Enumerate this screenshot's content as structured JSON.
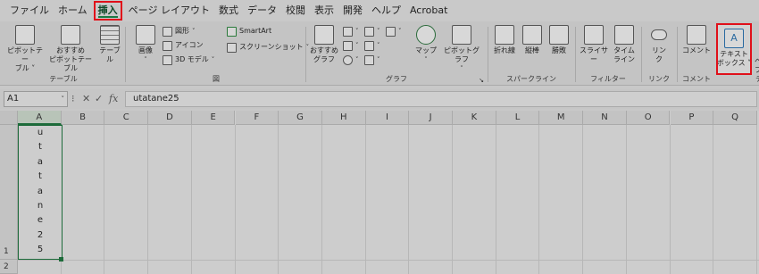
{
  "tabs": [
    "ファイル",
    "ホーム",
    "挿入",
    "ページ レイアウト",
    "数式",
    "データ",
    "校閲",
    "表示",
    "開発",
    "ヘルプ",
    "Acrobat"
  ],
  "active_tab": "挿入",
  "ribbon": {
    "table_group": {
      "label": "テーブル",
      "pivot": "ピボットテー\nブル ˅",
      "recommended_pivot": "おすすめ\nピボットテーブル",
      "table": "テーブル"
    },
    "illust_group": {
      "label": "図",
      "image": "画像",
      "shapes": "図形",
      "icons": "アイコン",
      "model3d": "3D モデル",
      "smartart": "SmartArt",
      "screenshot": "スクリーンショット"
    },
    "chart_group": {
      "label": "グラフ",
      "recommended": "おすすめ\nグラフ",
      "map": "マップ",
      "pivot_chart": "ピボットグラフ"
    },
    "sparkline_group": {
      "label": "スパークライン",
      "line": "折れ線",
      "column": "縦棒",
      "winloss": "勝敗"
    },
    "filter_group": {
      "label": "フィルター",
      "slicer": "スライサー",
      "timeline": "タイム\nライン"
    },
    "link_group": {
      "label": "リンク",
      "link": "リン\nク"
    },
    "comment_group": {
      "label": "コメント",
      "comment": "コメント"
    },
    "text_group": {
      "label": "テ",
      "textbox": "テキスト\nボックス ˅",
      "header": "ヘ\nフ"
    }
  },
  "namebox": "A1",
  "formula_value": "utatane25",
  "columns": [
    "A",
    "B",
    "C",
    "D",
    "E",
    "F",
    "G",
    "H",
    "I",
    "J",
    "K",
    "L",
    "M",
    "N",
    "O",
    "P",
    "Q"
  ],
  "rows": [
    "1",
    "2"
  ],
  "cell_A1_lines": [
    "u",
    "t",
    "a",
    "t",
    "a",
    "n",
    "e",
    "2",
    "5"
  ]
}
